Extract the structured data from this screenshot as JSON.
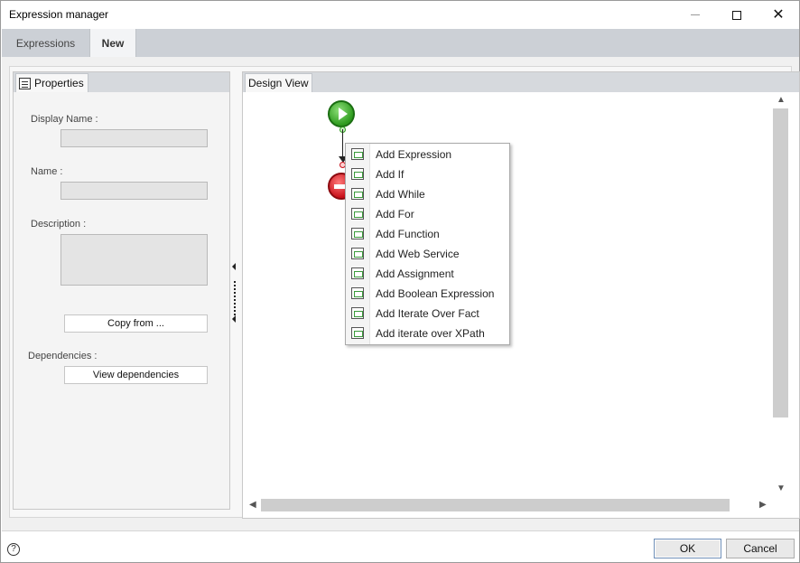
{
  "window": {
    "title": "Expression manager"
  },
  "tabs": [
    {
      "label": "Expressions",
      "active": false
    },
    {
      "label": "New",
      "active": true
    }
  ],
  "properties_panel": {
    "tab_label": "Properties",
    "display_name_label": "Display Name :",
    "display_name_value": "",
    "name_label": "Name :",
    "name_value": "",
    "description_label": "Description :",
    "description_value": "",
    "copy_from_button": "Copy from ...",
    "dependencies_label": "Dependencies :",
    "view_dependencies_button": "View dependencies"
  },
  "design_panel": {
    "tab_label": "Design View",
    "nodes": [
      {
        "kind": "start",
        "icon": "play-icon",
        "color": "#2e9b1e"
      },
      {
        "kind": "stop",
        "icon": "stop-icon",
        "color": "#c8101a"
      }
    ]
  },
  "context_menu": {
    "items": [
      {
        "label": "Add Expression",
        "icon": "expression-icon"
      },
      {
        "label": "Add If",
        "icon": "if-icon"
      },
      {
        "label": "Add While",
        "icon": "while-icon"
      },
      {
        "label": "Add For",
        "icon": "for-icon"
      },
      {
        "label": "Add Function",
        "icon": "function-icon"
      },
      {
        "label": "Add Web Service",
        "icon": "web-service-icon"
      },
      {
        "label": "Add Assignment",
        "icon": "assignment-icon"
      },
      {
        "label": "Add Boolean Expression",
        "icon": "boolean-expression-icon"
      },
      {
        "label": "Add Iterate Over Fact",
        "icon": "iterate-fact-icon"
      },
      {
        "label": "Add iterate over XPath",
        "icon": "iterate-xpath-icon"
      }
    ]
  },
  "footer": {
    "help_glyph": "?",
    "ok_button": "OK",
    "cancel_button": "Cancel"
  }
}
